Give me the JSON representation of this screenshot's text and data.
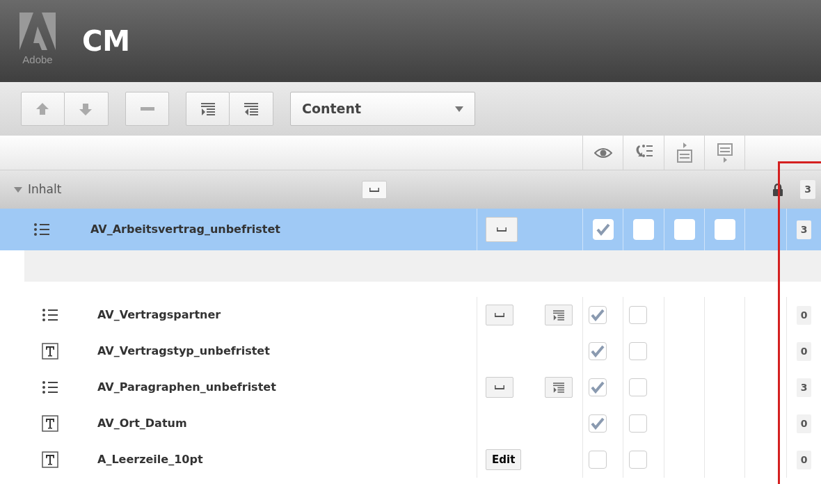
{
  "header": {
    "logo_text": "Adobe",
    "title": "CM"
  },
  "toolbar": {
    "view_select": {
      "value": "Content"
    }
  },
  "tree": [
    {
      "kind": "group",
      "label": "Inhalt",
      "expanded": true,
      "locked": true,
      "count": "3",
      "children": [
        {
          "kind": "document",
          "name": "AV_Arbeitsvertrag_unbefristet",
          "selected": true,
          "checks": [
            {
              "checked": true
            },
            {
              "checked": false
            },
            {
              "checked": false
            },
            {
              "checked": false
            }
          ],
          "count": "3",
          "children": [
            {
              "kind": "list",
              "name": "AV_Vertragspartner",
              "checks": [
                {
                  "checked": true
                },
                {
                  "checked": false
                }
              ],
              "count": "0"
            },
            {
              "kind": "text",
              "name": "AV_Vertragstyp_unbefristet",
              "checks": [
                {
                  "checked": true
                },
                {
                  "checked": false
                }
              ],
              "count": "0"
            },
            {
              "kind": "list",
              "name": "AV_Paragraphen_unbefristet",
              "checks": [
                {
                  "checked": true
                },
                {
                  "checked": false
                }
              ],
              "count": "3"
            },
            {
              "kind": "text",
              "name": "AV_Ort_Datum",
              "checks": [
                {
                  "checked": true
                },
                {
                  "checked": false
                }
              ],
              "count": "0"
            },
            {
              "kind": "text",
              "name": "A_Leerzeile_10pt",
              "edit_label": "Edit",
              "checks": [
                {
                  "checked": false
                },
                {
                  "checked": false
                }
              ],
              "count": "0"
            }
          ]
        }
      ]
    }
  ],
  "count_column_highlighted": true
}
